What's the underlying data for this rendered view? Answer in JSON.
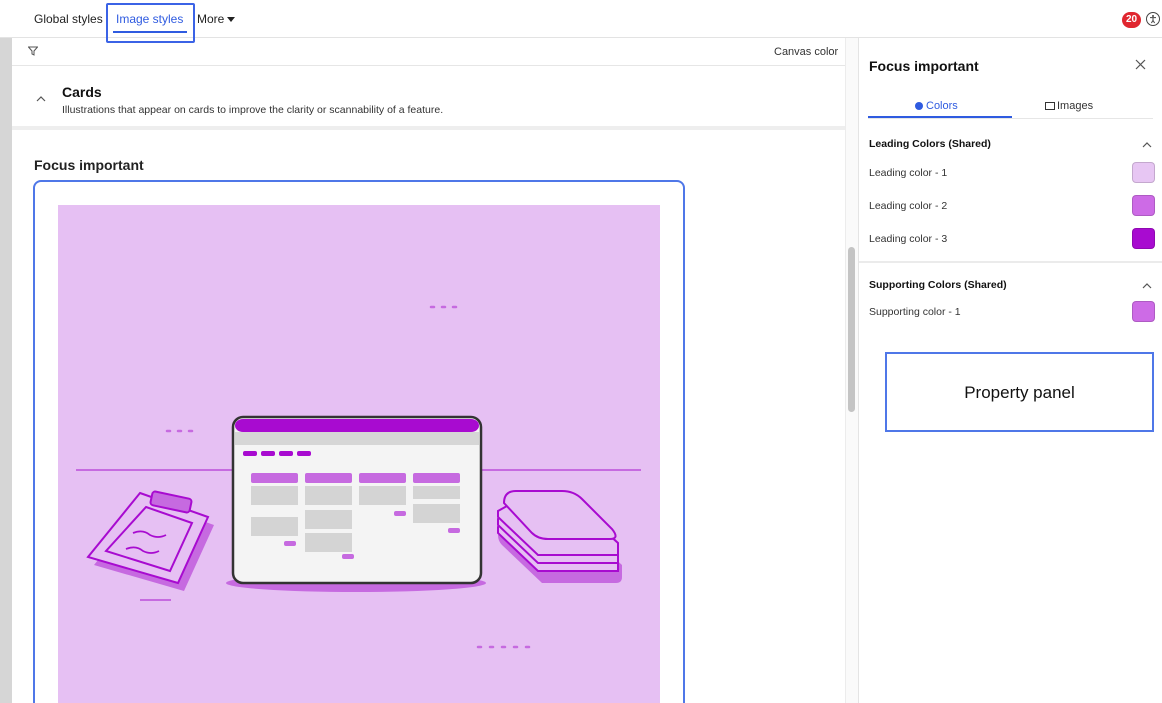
{
  "topbar": {
    "tabs": [
      {
        "label": "Global styles"
      },
      {
        "label": "Image styles",
        "active": true
      },
      {
        "label": "More"
      }
    ],
    "notification_count": "20",
    "accessibility_icon": "accessibility-icon"
  },
  "toolbar": {
    "filter_icon": "filter-icon",
    "canvas_color_label": "Canvas color"
  },
  "section": {
    "title": "Cards",
    "description": "Illustrations that appear on cards to improve the clarity or scannability of a feature."
  },
  "card": {
    "title": "Focus important"
  },
  "panel": {
    "title": "Focus important",
    "tabs": [
      {
        "label": "Colors",
        "icon": "dot-icon",
        "active": true
      },
      {
        "label": "Images",
        "icon": "image-icon"
      }
    ],
    "groups": [
      {
        "title": "Leading Colors (Shared)",
        "items": [
          {
            "label": "Leading color - 1",
            "color": "#e7c6f3"
          },
          {
            "label": "Leading color - 2",
            "color": "#cd6be6"
          },
          {
            "label": "Leading color - 3",
            "color": "#a80bd0"
          }
        ]
      },
      {
        "title": "Supporting Colors (Shared)",
        "items": [
          {
            "label": "Supporting color - 1",
            "color": "#cd6be6"
          }
        ]
      }
    ]
  },
  "annotation": {
    "label": "Property panel"
  },
  "colors": {
    "accent": "#2f5be0",
    "illustration_bg": "#e6c0f3",
    "illustration_mid": "#c66ae0",
    "illustration_dark": "#a80bd0"
  }
}
